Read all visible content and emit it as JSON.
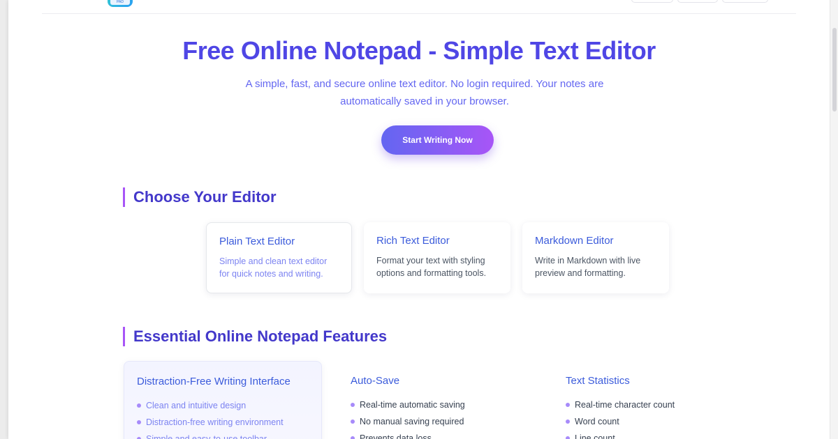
{
  "hero": {
    "title": "Free Online Notepad - Simple Text Editor",
    "subtitle": "A simple, fast, and secure online text editor. No login required. Your notes are automatically saved in your browser.",
    "cta_label": "Start Writing Now"
  },
  "logo": {
    "text": "PAD"
  },
  "editors_section": {
    "title": "Choose Your Editor",
    "cards": [
      {
        "title": "Plain Text Editor",
        "desc": "Simple and clean text editor for quick notes and writing."
      },
      {
        "title": "Rich Text Editor",
        "desc": "Format your text with styling options and formatting tools."
      },
      {
        "title": "Markdown Editor",
        "desc": "Write in Markdown with live preview and formatting."
      }
    ]
  },
  "features_section": {
    "title": "Essential Online Notepad Features",
    "features": [
      {
        "title": "Distraction-Free Writing Interface",
        "items": [
          "Clean and intuitive design",
          "Distraction-free writing environment",
          "Simple and easy-to-use toolbar"
        ]
      },
      {
        "title": "Auto-Save",
        "items": [
          "Real-time automatic saving",
          "No manual saving required",
          "Prevents data loss"
        ]
      },
      {
        "title": "Text Statistics",
        "items": [
          "Real-time character count",
          "Word count",
          "Line count"
        ]
      }
    ]
  },
  "colors": {
    "accent": "#4f46e5",
    "gradient_start": "#6366f1",
    "gradient_end": "#a855f7",
    "card_title": "#3b5bdb"
  }
}
